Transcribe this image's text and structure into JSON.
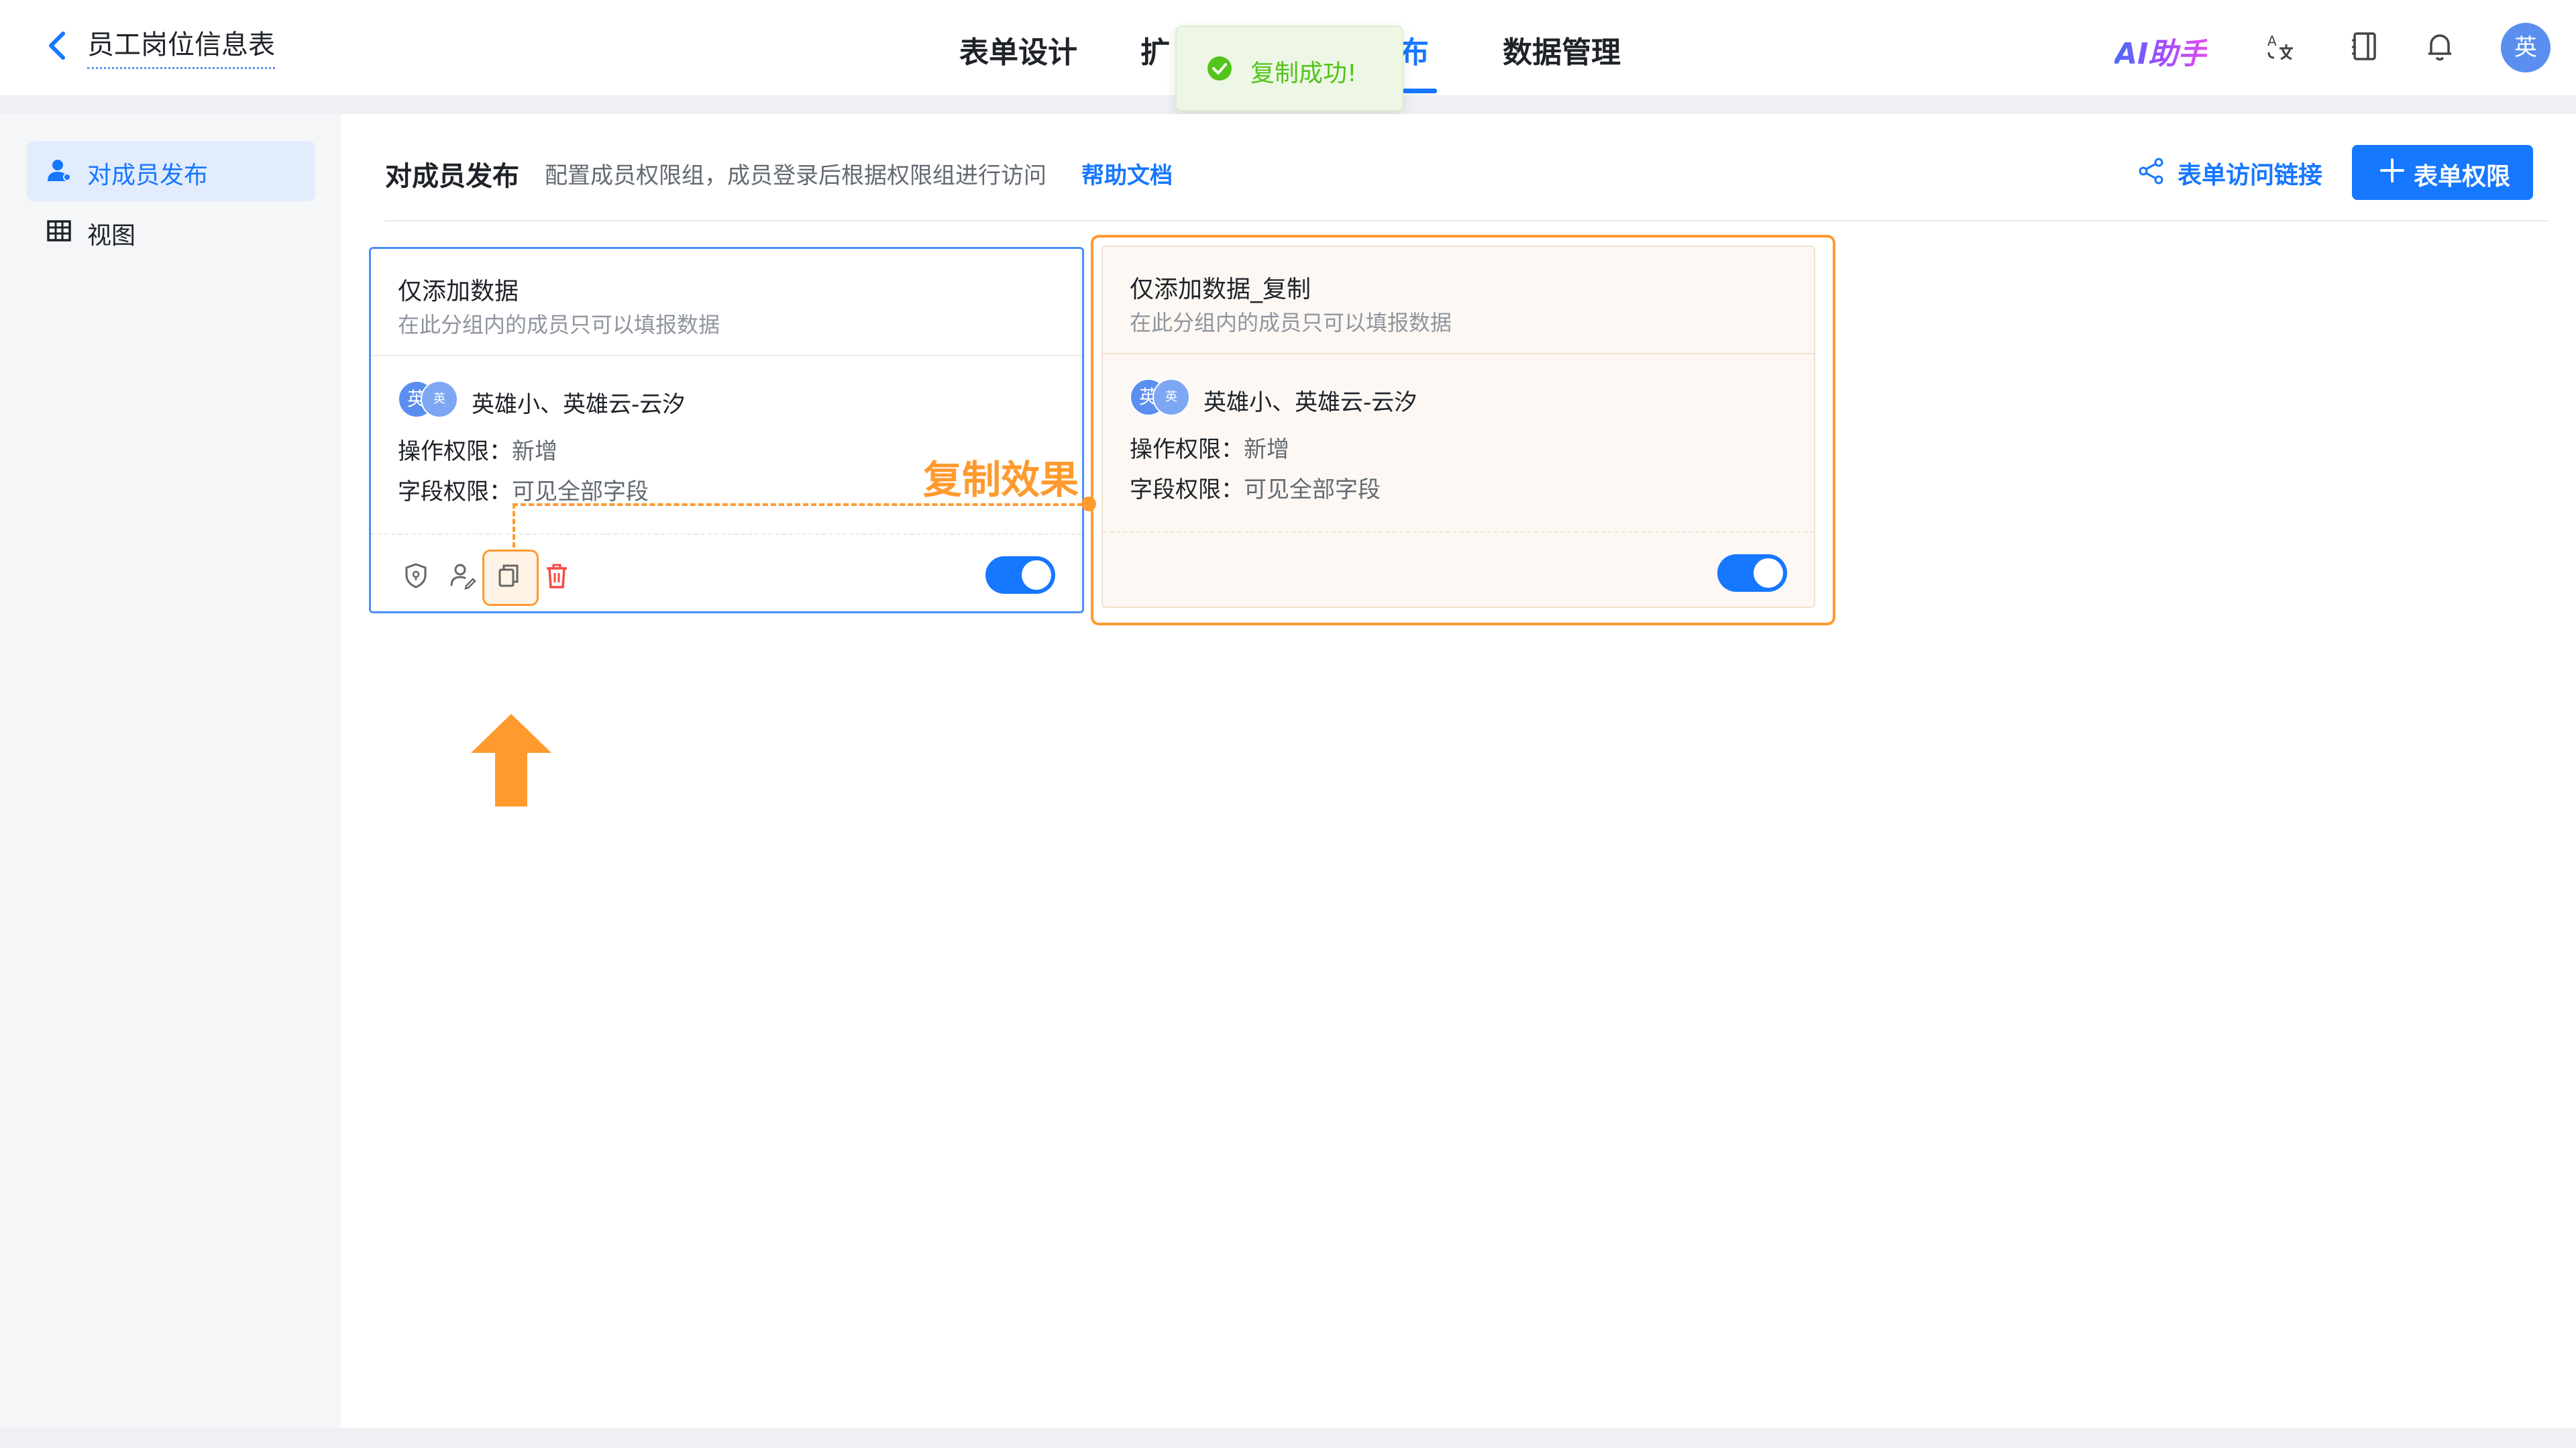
{
  "header": {
    "doc_title": "员工岗位信息表",
    "tabs": [
      {
        "label": "表单设计"
      },
      {
        "label": "扩"
      },
      {
        "label": "布"
      },
      {
        "label": "数据管理"
      }
    ],
    "ai_label": "AI助手",
    "avatar_text": "英",
    "icons": [
      "back-icon",
      "translate-icon",
      "book-icon",
      "bell-icon"
    ]
  },
  "toast": {
    "message": "复制成功!",
    "icon": "check-circle-icon",
    "color": "#52c41a"
  },
  "sidebar": {
    "items": [
      {
        "label": "对成员发布",
        "icon": "user-icon",
        "active": true
      },
      {
        "label": "视图",
        "icon": "table-icon",
        "active": false
      }
    ]
  },
  "section": {
    "title": "对成员发布",
    "description": "配置成员权限组，成员登录后根据权限组进行访问",
    "help_link": "帮助文档",
    "share_link": "表单访问链接",
    "add_button": "表单权限"
  },
  "cards": [
    {
      "title": "仅添加数据",
      "subtitle": "在此分组内的成员只可以填报数据",
      "avatar_1": "英",
      "avatar_2": "英",
      "members": "英雄小、英雄云-云汐",
      "op_label": "操作权限：",
      "op_value": "新增",
      "field_label": "字段权限：",
      "field_value": "可见全部字段",
      "enabled": true
    },
    {
      "title": "仅添加数据_复制",
      "subtitle": "在此分组内的成员只可以填报数据",
      "avatar_1": "英",
      "avatar_2": "英",
      "members": "英雄小、英雄云-云汐",
      "op_label": "操作权限：",
      "op_value": "新增",
      "field_label": "字段权限：",
      "field_value": "可见全部字段",
      "enabled": true
    }
  ],
  "annotation": {
    "text": "复制效果",
    "color": "#ff9a2e"
  },
  "colors": {
    "primary": "#1677ff",
    "accent": "#ff9a2e",
    "success": "#52c41a"
  }
}
